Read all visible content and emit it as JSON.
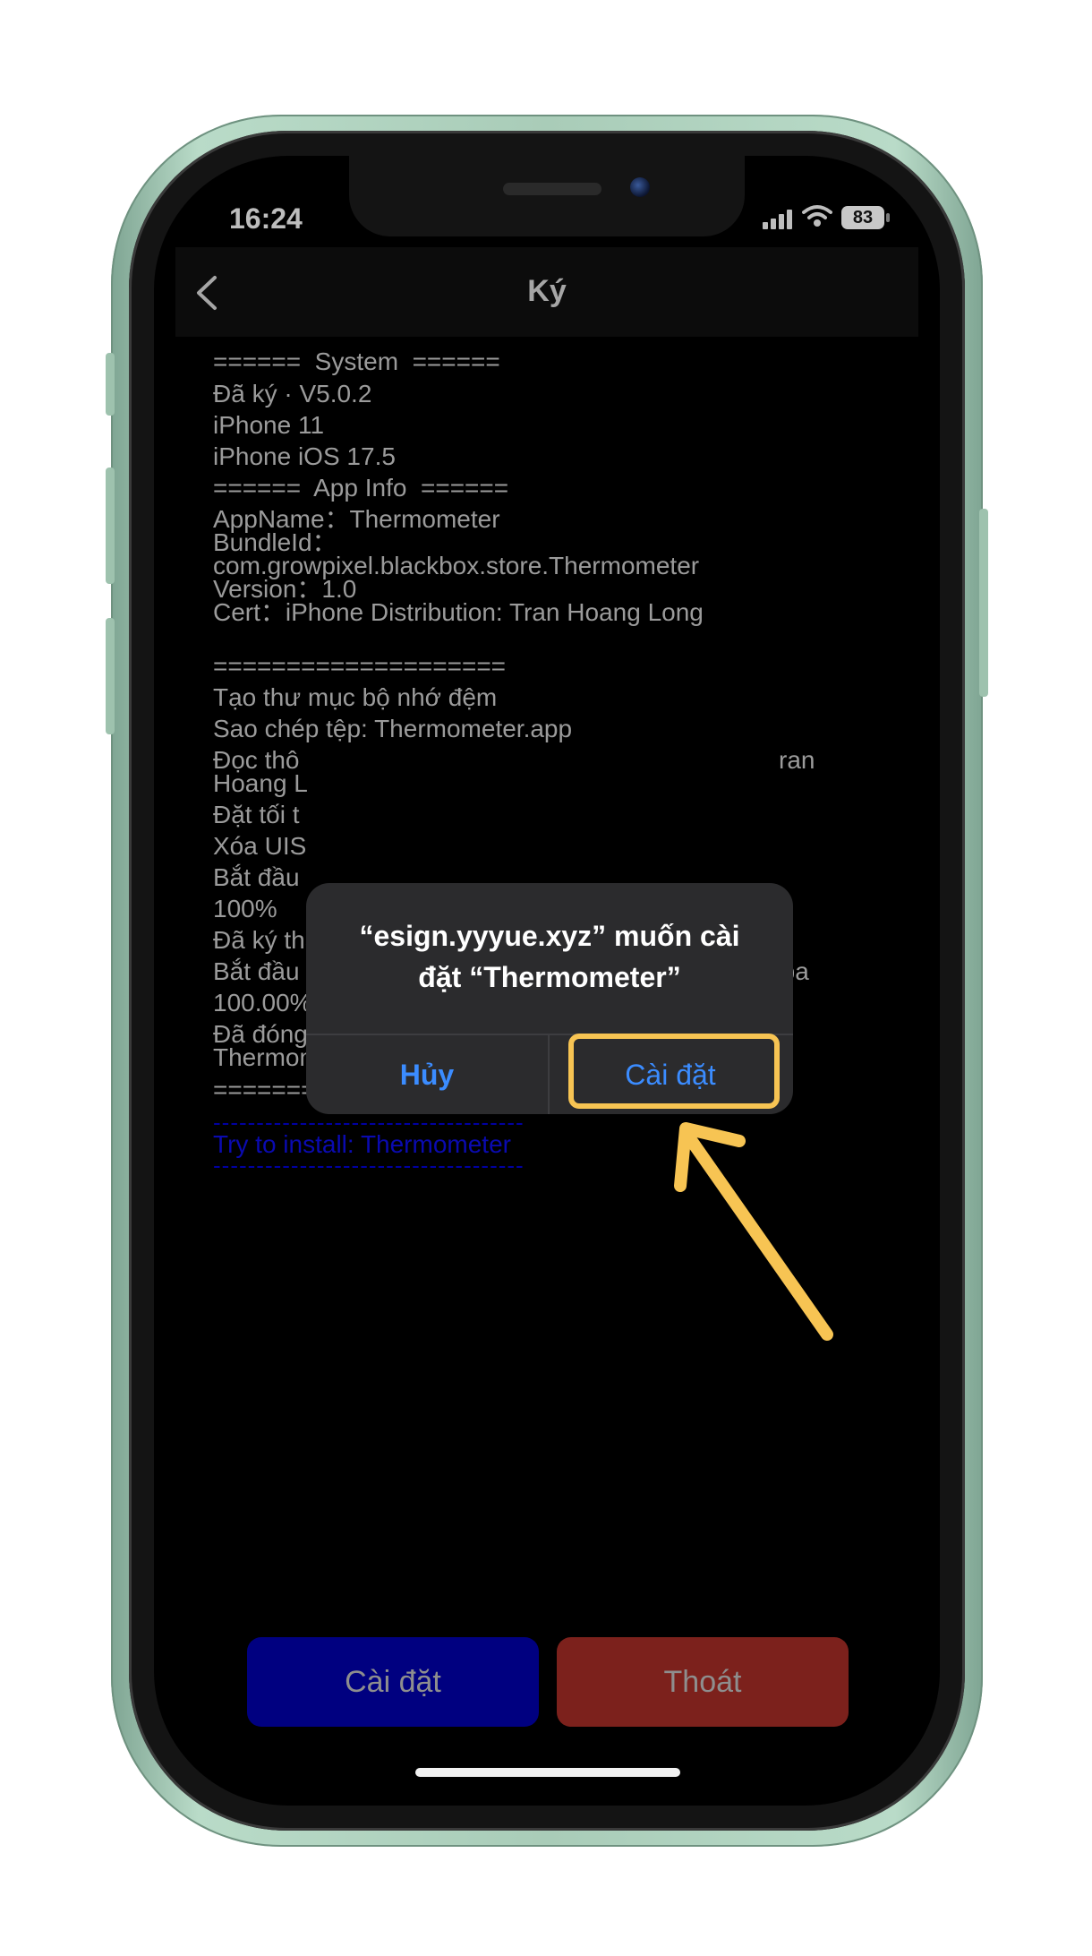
{
  "status_bar": {
    "time": "16:24",
    "battery": "83",
    "icons": [
      "signal-icon",
      "wifi-icon",
      "battery-icon"
    ]
  },
  "nav": {
    "title": "Ký",
    "back_icon": "chevron-left-icon"
  },
  "log": {
    "lines": [
      "======  System  ======",
      "Đã ký · V5.0.2",
      "iPhone 11",
      "iPhone iOS 17.5",
      "======  App Info  ======",
      "AppName：Thermometer",
      "BundleId：",
      "com.growpixel.blackbox.store.Thermometer",
      "Version：1.0",
      "Cert：iPhone Distribution: Tran Hoang Long",
      "====================",
      "Tạo thư mục bộ nhớ đệm",
      "Sao chép tệp: Thermometer.app",
      "Đọc thô",
      "ran",
      "Hoang L",
      "Đặt tối t",
      "Xóa UIS",
      "Bắt đầu",
      "100%",
      "Đã ký thành công",
      "Bắt đầu đóng gói: Thermometer_1.0_1712136234.ipa",
      "100.00%",
      "Đã đóng gói thành công:",
      "Thermometer_1.0_1712136234.ipa",
      "===================="
    ],
    "dashes": "------------------------------------",
    "install_link": "Try to install: Thermometer"
  },
  "buttons": {
    "install": "Cài đặt",
    "exit": "Thoát"
  },
  "alert": {
    "title_line1": "“esign.yyyue.xyz” muốn cài",
    "title_line2": "đặt “Thermometer”",
    "cancel": "Hủy",
    "install": "Cài đặt"
  },
  "colors": {
    "annotation": "#f7c453",
    "alert_button": "#3b8cff",
    "install_button_bg": "#000080",
    "exit_button_bg": "#7c211c",
    "phone_frame": "#a9ccb8"
  }
}
